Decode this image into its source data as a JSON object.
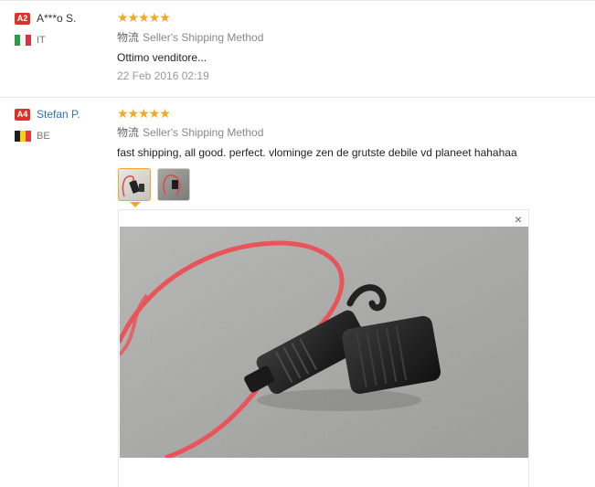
{
  "reviews": [
    {
      "badge": "A2",
      "user": "A***o S.",
      "country": "IT",
      "rating": 5,
      "stars": "★★★★★",
      "shipping_cn": "物流",
      "shipping": "Seller's Shipping Method",
      "text": "Ottimo venditore...",
      "date": "22 Feb 2016 02:19"
    },
    {
      "badge": "A4",
      "user": "Stefan P.",
      "country": "BE",
      "rating": 5,
      "stars": "★★★★★",
      "shipping_cn": "物流",
      "shipping": "Seller's Shipping Method",
      "text": "fast shipping, all good. perfect. vlominge zen de grutste debile vd planeet hahahaa",
      "thumbnail_count": 2,
      "selected_thumbnail": 1
    }
  ],
  "viewer": {
    "close_label": "×"
  },
  "colors": {
    "star": "#f5a623",
    "badge": "#d9342b",
    "link": "#2d6fd1",
    "selected_border": "#f5a623"
  }
}
